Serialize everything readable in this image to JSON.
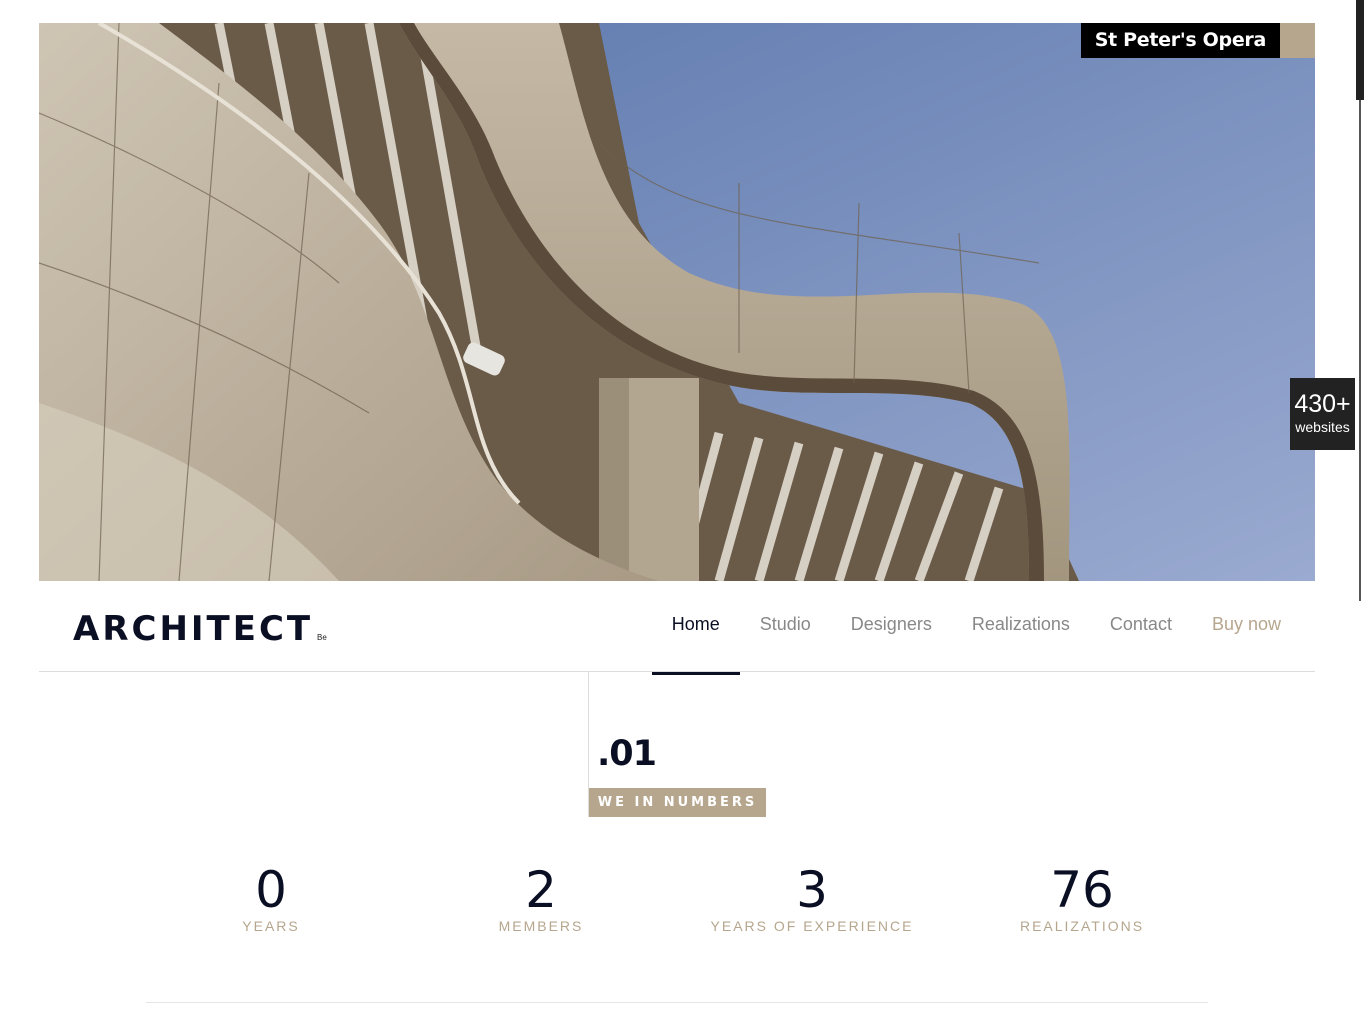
{
  "hero": {
    "caption": "St Peter's Opera",
    "colors": {
      "sky": "#5f7fb2",
      "facade": "#b9ad9a",
      "shadow": "#544637"
    }
  },
  "header": {
    "logo": "ARCHITECT",
    "logo_suffix": "Be",
    "nav": [
      "Home",
      "Studio",
      "Designers",
      "Realizations",
      "Contact",
      "Buy now"
    ],
    "active": "Home"
  },
  "section": {
    "number": ".01",
    "label": "WE IN NUMBERS"
  },
  "stats": [
    {
      "value": "0",
      "label": "YEARS"
    },
    {
      "value": "2",
      "label": "MEMBERS"
    },
    {
      "value": "3",
      "label": "YEARS OF EXPERIENCE"
    },
    {
      "value": "76",
      "label": "REALIZATIONS"
    }
  ],
  "badge": {
    "value": "430+",
    "label": "websites"
  },
  "colors": {
    "accent": "#b6a68e",
    "dark": "#0b0f24"
  }
}
